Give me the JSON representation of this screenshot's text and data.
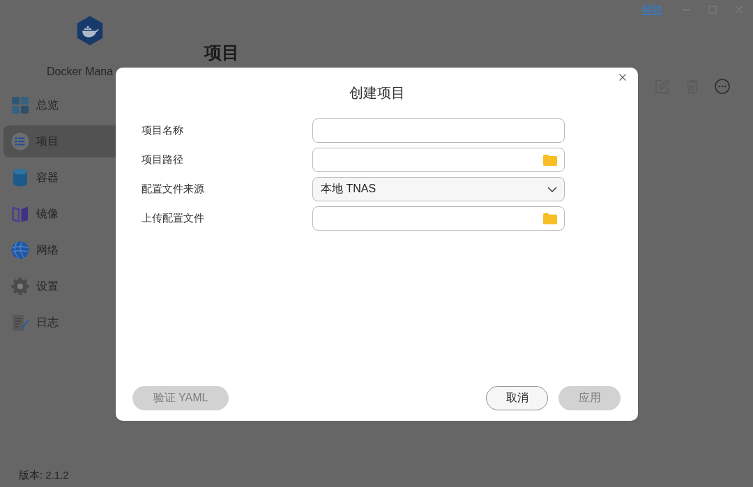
{
  "window": {
    "help_link": "帮助"
  },
  "sidebar": {
    "app_name": "Docker Mana",
    "items": [
      {
        "label": "总览",
        "selected": false
      },
      {
        "label": "项目",
        "selected": true
      },
      {
        "label": "容器",
        "selected": false
      },
      {
        "label": "镜像",
        "selected": false
      },
      {
        "label": "网络",
        "selected": false
      },
      {
        "label": "设置",
        "selected": false
      },
      {
        "label": "日志",
        "selected": false
      }
    ],
    "version": "版本: 2.1.2"
  },
  "page": {
    "title": "项目"
  },
  "dialog": {
    "title": "创建项目",
    "fields": [
      {
        "label": "项目名称",
        "kind": "text"
      },
      {
        "label": "项目路径",
        "kind": "folder"
      },
      {
        "label": "配置文件来源",
        "kind": "select",
        "value": "本地 TNAS"
      },
      {
        "label": "上传配置文件",
        "kind": "folder"
      }
    ],
    "buttons": [
      {
        "label": "验证 YAML",
        "disabled": true
      },
      {
        "label": "取消",
        "disabled": false
      },
      {
        "label": "应用",
        "disabled": true
      }
    ]
  }
}
